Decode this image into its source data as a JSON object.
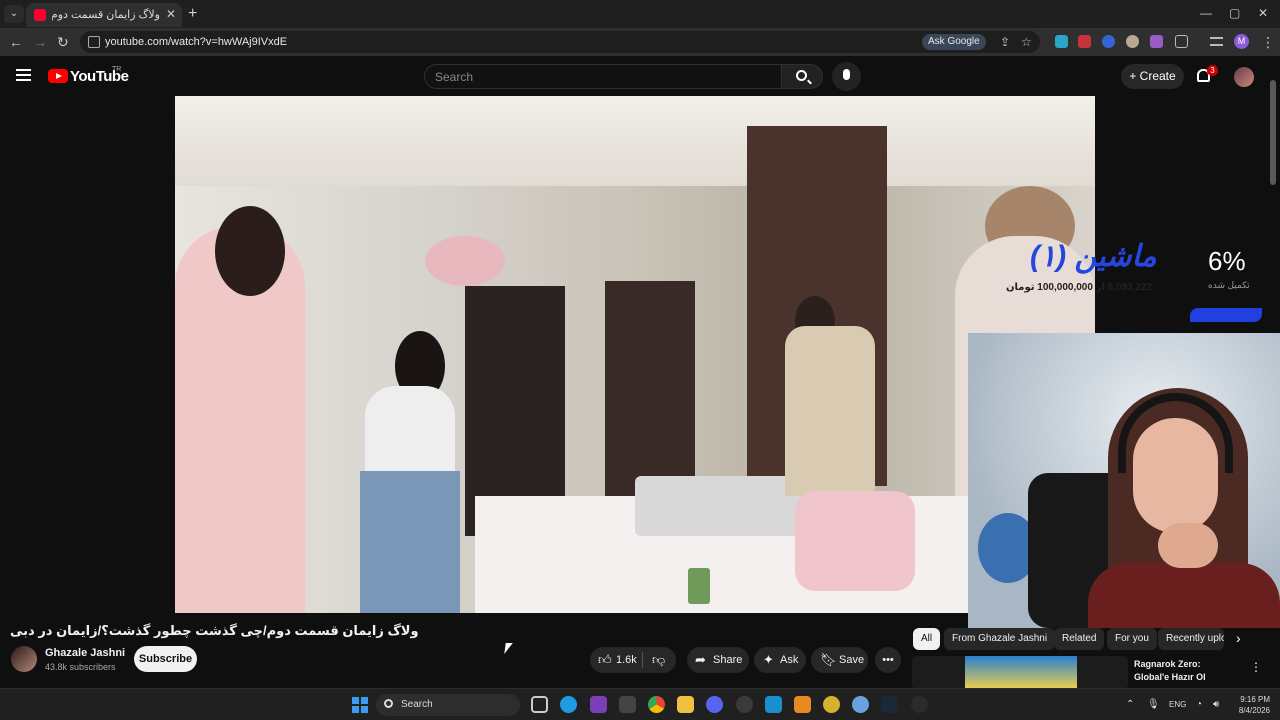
{
  "browser": {
    "tab": {
      "title": "ولاگ زایمان قسمت دوم (3)"
    },
    "url": "youtube.com/watch?v=hwWAj9IVxdE",
    "ask_google_label": "Ask Google",
    "profile_initial": "M"
  },
  "youtube": {
    "logo_text": "YouTube",
    "region": "TR",
    "search_placeholder": "Search",
    "create_label": "Create",
    "notifications_count": "3"
  },
  "overlay": {
    "donation_title": "ماشین (۱)",
    "donation_amount": "6,093,222 از 100,000,000 تومان",
    "donation_percent": "6%",
    "donation_label": "تکمیل شده",
    "progress_fraction": 0.06
  },
  "video": {
    "title": "ولاگ زایمان قسمت دوم/چی گذشت چطور گذشت؟/زایمان در دبی",
    "channel_name": "Ghazale Jashni",
    "subscribers": "43.8k subscribers",
    "subscribe_label": "Subscribe",
    "like_count": "1.6k",
    "share_label": "Share",
    "ask_label": "Ask",
    "save_label": "Save"
  },
  "chips": [
    "All",
    "From Ghazale Jashni",
    "Related",
    "For you",
    "Recently uplo"
  ],
  "recommended": [
    {
      "title": "Ragnarok Zero: Global'e Hazır Ol"
    }
  ],
  "taskbar": {
    "search_label": "Search",
    "language": "ENG",
    "time": "9:16 PM",
    "date": "8/4/2026"
  },
  "colors": {
    "youtube_red": "#ff0000",
    "donation_blue": "#2746e0",
    "background": "#0f0f0f"
  }
}
